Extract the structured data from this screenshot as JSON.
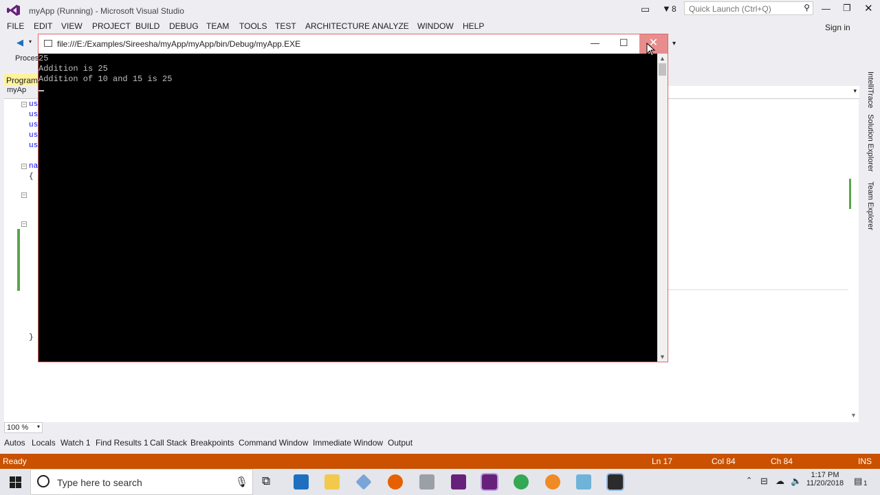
{
  "vs": {
    "title": "myApp (Running) - Microsoft Visual Studio",
    "notif_count": "8",
    "quick_launch_placeholder": "Quick Launch (Ctrl+Q)",
    "sign_in": "Sign in",
    "menu": [
      "FILE",
      "EDIT",
      "VIEW",
      "PROJECT",
      "BUILD",
      "DEBUG",
      "TEAM",
      "TOOLS",
      "TEST",
      "ARCHITECTURE",
      "ANALYZE",
      "WINDOW",
      "HELP"
    ],
    "process_label": "Proces",
    "doc_tab": "Program.",
    "nav_drop": "myAp",
    "code_lines": [
      "us",
      "us",
      "us",
      "us",
      "us",
      "na",
      "{",
      "}"
    ],
    "zoom": "100 %",
    "side_tabs": [
      "IntelliTrace",
      "Solution Explorer",
      "Team Explorer"
    ]
  },
  "console": {
    "title": "file:///E:/Examples/Sireesha/myApp/myApp/bin/Debug/myApp.EXE",
    "lines": [
      "25",
      "Addition is 25",
      "Addition of 10 and 15 is 25"
    ]
  },
  "tool_tabs": [
    "Autos",
    "Locals",
    "Watch 1",
    "Find Results 1",
    "Call Stack",
    "Breakpoints",
    "Command Window",
    "Immediate Window",
    "Output"
  ],
  "status": {
    "ready": "Ready",
    "ln": "Ln 17",
    "col": "Col 84",
    "ch": "Ch 84",
    "ins": "INS"
  },
  "taskbar": {
    "search_placeholder": "Type here to search",
    "time": "1:17 PM",
    "date": "11/20/2018",
    "notification_count": "1"
  },
  "colors": {
    "status_bar": "#ca5100",
    "close_hover": "#e88d8d",
    "console_bg": "#000000"
  }
}
